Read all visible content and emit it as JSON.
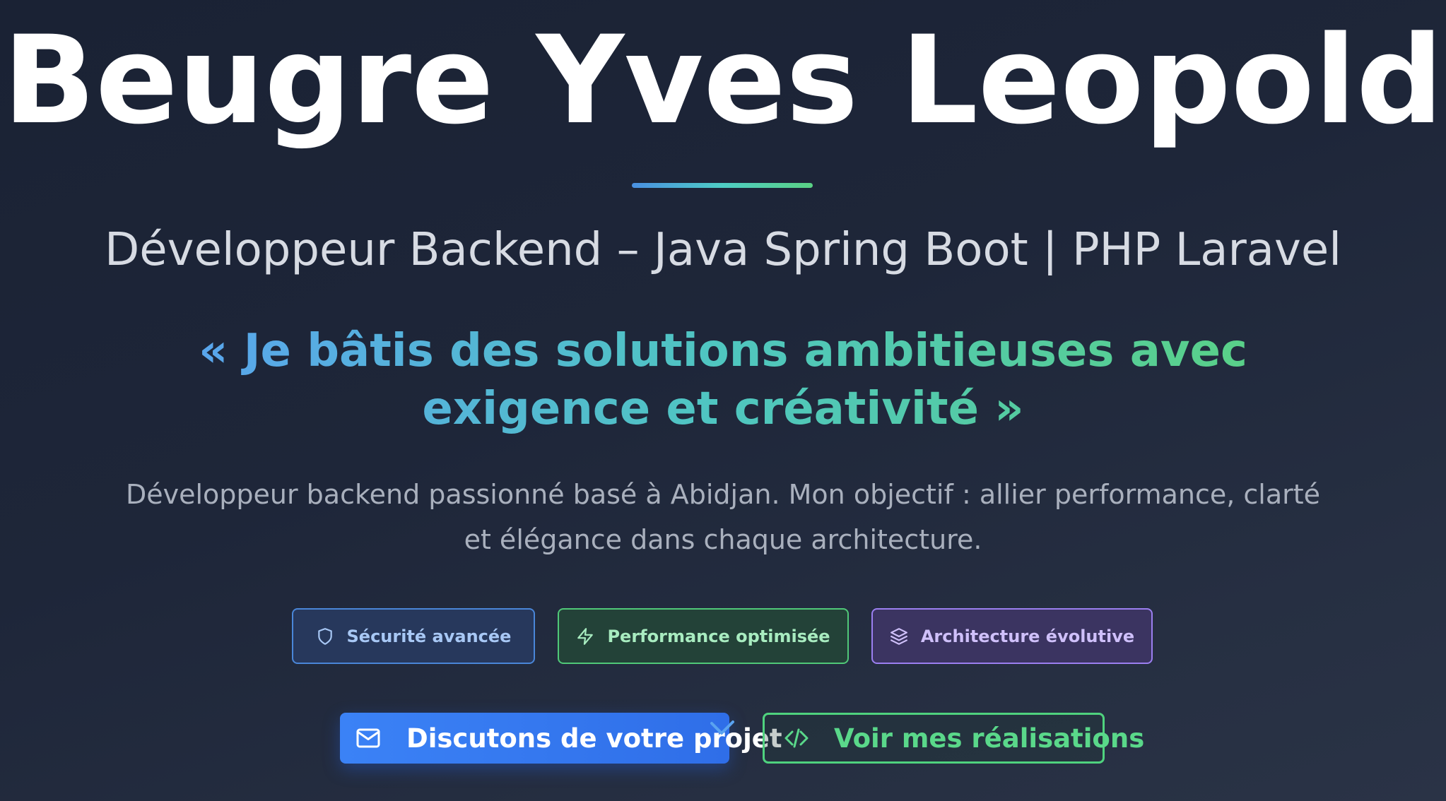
{
  "hero": {
    "name": "Beugre Yves Leopold",
    "role": "Développeur Backend – Java Spring Boot | PHP Laravel",
    "quote": "« Je bâtis des solutions ambitieuses avec exigence et créativité »",
    "description": "Développeur backend passionné basé à Abidjan. Mon objectif : allier performance, clarté et élégance dans chaque architecture."
  },
  "badges": [
    {
      "label": "Sécurité avancée",
      "icon": "shield-icon",
      "color": "#4a86d8"
    },
    {
      "label": "Performance optimisée",
      "icon": "lightning-icon",
      "color": "#50c878"
    },
    {
      "label": "Architecture évolutive",
      "icon": "layers-icon",
      "color": "#9b7ff0"
    }
  ],
  "actions": {
    "contact_label": "Discutons de votre projet",
    "contact_icon": "mail-icon",
    "projects_label": "Voir mes réalisations",
    "projects_icon": "code-icon"
  },
  "colors": {
    "background": "#1e2639",
    "primary": "#3b82f6",
    "accent_green": "#4fd27e",
    "accent_purple": "#9b7ff0"
  }
}
